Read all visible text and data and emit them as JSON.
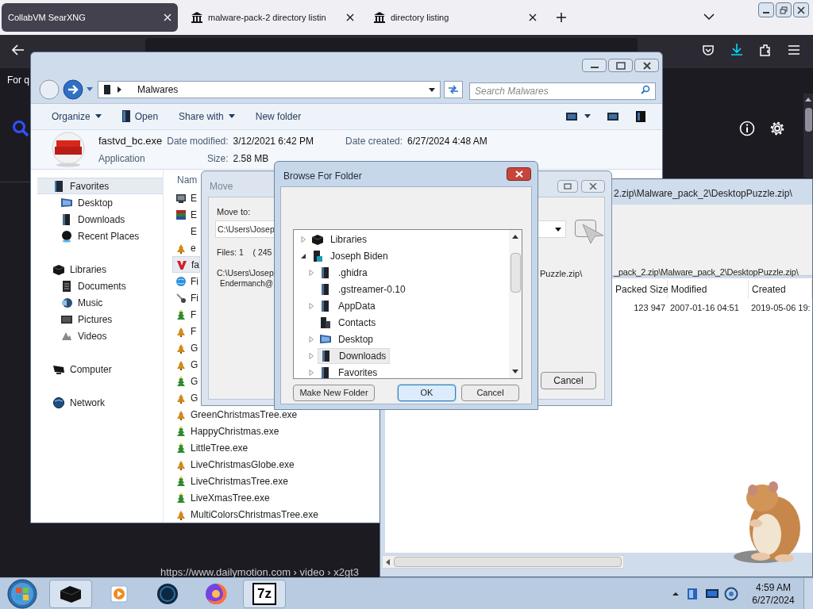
{
  "browser": {
    "tabs": [
      {
        "label": "CollabVM SearXNG",
        "selected": true,
        "has_icon": false
      },
      {
        "label": "malware-pack-2 directory listin",
        "selected": false,
        "has_icon": true
      },
      {
        "label": "directory listing",
        "selected": false,
        "has_icon": true
      }
    ],
    "page_fragment": "For q",
    "result_url": "https://www.dailymotion.com › video › x2gt3"
  },
  "explorer": {
    "address": "Malwares",
    "search_placeholder": "Search Malwares",
    "toolbar": [
      {
        "label": "Organize",
        "kind": "dropdown"
      },
      {
        "label": "Open",
        "kind": "open"
      },
      {
        "label": "Share with",
        "kind": "dropdown"
      },
      {
        "label": "New folder",
        "kind": "plain"
      }
    ],
    "details": {
      "name": "fastvd_bc.exe",
      "type": "Application",
      "modified_label": "Date modified:",
      "modified": "3/12/2021 6:42 PM",
      "size_label": "Size:",
      "size": "2.58 MB",
      "created_label": "Date created:",
      "created": "6/27/2024 4:48 AM"
    },
    "nav": [
      {
        "label": "Favorites",
        "kind": "book",
        "selected": true,
        "children": [
          {
            "label": "Desktop",
            "kind": "desktop",
            "selected": false
          },
          {
            "label": "Downloads",
            "kind": "folder",
            "selected": false
          },
          {
            "label": "Recent Places",
            "kind": "sphere",
            "selected": false
          }
        ]
      },
      {
        "label": "Libraries",
        "kind": "box",
        "selected": false,
        "children": [
          {
            "label": "Documents",
            "kind": "document",
            "selected": false
          },
          {
            "label": "Music",
            "kind": "music",
            "selected": false
          },
          {
            "label": "Pictures",
            "kind": "picture",
            "selected": false
          },
          {
            "label": "Videos",
            "kind": "video",
            "selected": false
          }
        ]
      },
      {
        "label": "Computer",
        "kind": "computer",
        "selected": false
      },
      {
        "label": "Network",
        "kind": "network",
        "selected": false
      }
    ],
    "name_column": "Nam",
    "files": [
      {
        "name": "E",
        "kind": "monitor",
        "selected": false
      },
      {
        "name": "E",
        "kind": "archive",
        "selected": false
      },
      {
        "name": "E",
        "kind": "blank",
        "selected": false
      },
      {
        "name": "e",
        "kind": "bell",
        "selected": false
      },
      {
        "name": "fa",
        "kind": "chevron",
        "selected": true
      },
      {
        "name": "Fi",
        "kind": "globe",
        "selected": false
      },
      {
        "name": "Fi",
        "kind": "tool",
        "selected": false
      },
      {
        "name": "F",
        "kind": "tree",
        "selected": false
      },
      {
        "name": "F",
        "kind": "bell",
        "selected": false
      },
      {
        "name": "G",
        "kind": "bell",
        "selected": false
      },
      {
        "name": "G",
        "kind": "bell",
        "selected": false
      },
      {
        "name": "G",
        "kind": "tree",
        "selected": false
      },
      {
        "name": "G",
        "kind": "bell",
        "selected": false
      },
      {
        "name": "GreenChristmasTree.exe",
        "kind": "bell",
        "selected": false
      },
      {
        "name": "HappyChristmas.exe",
        "kind": "tree",
        "selected": false
      },
      {
        "name": "LittleTree.exe",
        "kind": "tree",
        "selected": false
      },
      {
        "name": "LiveChristmasGlobe.exe",
        "kind": "bell",
        "selected": false
      },
      {
        "name": "LiveChristmasTree.exe",
        "kind": "tree",
        "selected": false
      },
      {
        "name": "LiveXmasTree.exe",
        "kind": "tree",
        "selected": false
      },
      {
        "name": "MultiColorsChristmasTree.exe",
        "kind": "bell",
        "selected": false
      }
    ]
  },
  "move_dialog": {
    "title": "Move",
    "move_to_label": "Move to:",
    "path": "C:\\Users\\Josep",
    "files_info": "Files: 1    ( 245",
    "source_line_1": "C:\\Users\\Josep",
    "source_line_2": "Endermanch@",
    "source_tail": "Puzzle.zip\\",
    "cancel": "Cancel"
  },
  "browse_dialog": {
    "title": "Browse For Folder",
    "tree": [
      {
        "label": "Libraries",
        "kind": "box",
        "expandable": true,
        "expanded": false,
        "selected": false
      },
      {
        "label": "Joseph Biden",
        "kind": "user",
        "expandable": true,
        "expanded": true,
        "selected": false,
        "children": [
          {
            "label": ".ghidra",
            "kind": "folder",
            "expandable": true,
            "expanded": false,
            "selected": false
          },
          {
            "label": ".gstreamer-0.10",
            "kind": "folder",
            "expandable": false,
            "selected": false
          },
          {
            "label": "AppData",
            "kind": "folder",
            "expandable": true,
            "expanded": false,
            "selected": false
          },
          {
            "label": "Contacts",
            "kind": "contacts",
            "expandable": false,
            "selected": false
          },
          {
            "label": "Desktop",
            "kind": "desktop",
            "expandable": true,
            "expanded": false,
            "selected": false
          },
          {
            "label": "Downloads",
            "kind": "folder",
            "expandable": true,
            "expanded": false,
            "selected": true
          },
          {
            "label": "Favorites",
            "kind": "folder",
            "expandable": true,
            "expanded": false,
            "selected": false
          }
        ]
      }
    ],
    "buttons": [
      {
        "label": "Make New Folder",
        "kind": "plain"
      },
      {
        "label": "OK",
        "kind": "default"
      },
      {
        "label": "Cancel",
        "kind": "plain"
      }
    ]
  },
  "archive_window": {
    "title": "2.zip\\Malware_pack_2\\DesktopPuzzle.zip\\",
    "path": "_pack_2.zip\\Malware_pack_2\\DesktopPuzzle.zip\\",
    "columns": [
      "Packed Size",
      "Modified",
      "Created"
    ],
    "rows": [
      [
        "123 947",
        "2007-01-16 04:51",
        "2019-05-06 19:"
      ]
    ]
  },
  "taskbar": {
    "apps": [
      {
        "kind": "box"
      },
      {
        "kind": "player"
      },
      {
        "kind": "globe"
      },
      {
        "kind": "firefox"
      },
      {
        "kind": "archiver",
        "label": "7z"
      }
    ],
    "time": "4:59 AM",
    "date": "6/27/2024"
  }
}
